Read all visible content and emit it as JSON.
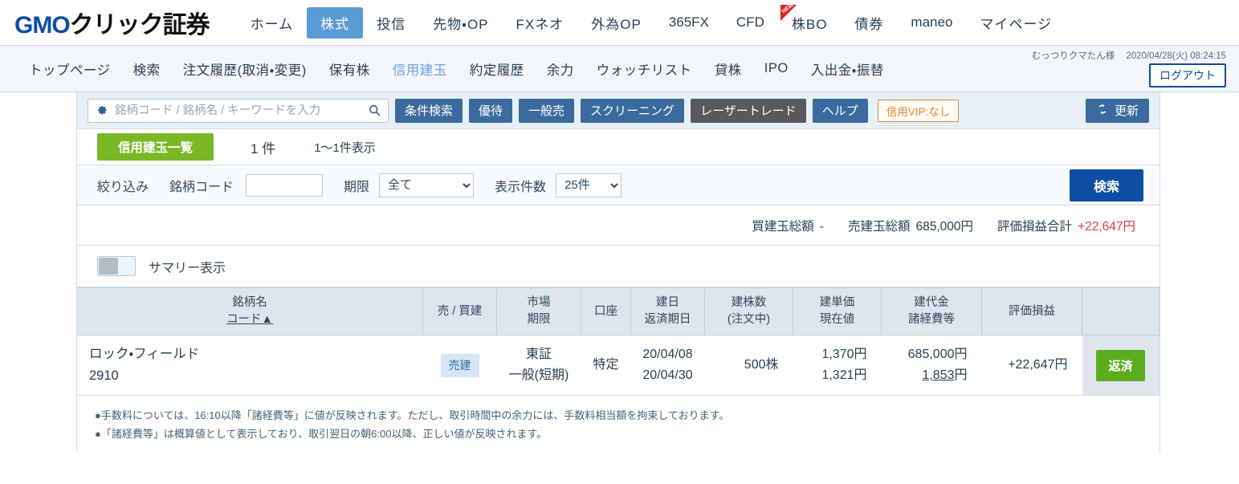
{
  "brand": {
    "gmo": "GMO",
    "name": "クリック証券"
  },
  "globalnav": [
    {
      "label": "ホーム",
      "active": false,
      "latin": false,
      "new": false
    },
    {
      "label": "株式",
      "active": true,
      "latin": false,
      "new": false
    },
    {
      "label": "投信",
      "active": false,
      "latin": false,
      "new": false
    },
    {
      "label": "先物・OP",
      "active": false,
      "latin": false,
      "new": false
    },
    {
      "label": "FXネオ",
      "active": false,
      "latin": false,
      "new": false
    },
    {
      "label": "外為OP",
      "active": false,
      "latin": false,
      "new": false
    },
    {
      "label": "365FX",
      "active": false,
      "latin": true,
      "new": false
    },
    {
      "label": "CFD",
      "active": false,
      "latin": true,
      "new": false
    },
    {
      "label": "株BO",
      "active": false,
      "latin": false,
      "new": true,
      "new_label": "NEW"
    },
    {
      "label": "債券",
      "active": false,
      "latin": false,
      "new": false
    },
    {
      "label": "maneo",
      "active": false,
      "latin": true,
      "new": false
    },
    {
      "label": "マイページ",
      "active": false,
      "latin": false,
      "new": false
    }
  ],
  "subnav": [
    {
      "label": "トップページ",
      "active": false
    },
    {
      "label": "検索",
      "active": false
    },
    {
      "label": "注文履歴(取消・変更)",
      "active": false
    },
    {
      "label": "保有株",
      "active": false
    },
    {
      "label": "信用建玉",
      "active": true
    },
    {
      "label": "約定履歴",
      "active": false
    },
    {
      "label": "余力",
      "active": false
    },
    {
      "label": "ウォッチリスト",
      "active": false
    },
    {
      "label": "貸株",
      "active": false
    },
    {
      "label": "IPO",
      "active": false
    },
    {
      "label": "入出金・振替",
      "active": false
    }
  ],
  "user": {
    "name": "むっつりクマたん様",
    "datetime": "2020/04/28(火) 08:24:15",
    "logout_label": "ログアウト"
  },
  "toolbar": {
    "search_placeholder": "銘柄コード / 銘柄名 / キーワードを入力",
    "search_value": "",
    "buttons": [
      {
        "label": "条件検索",
        "style": "blue"
      },
      {
        "label": "優待",
        "style": "blue"
      },
      {
        "label": "一般売",
        "style": "blue"
      },
      {
        "label": "スクリーニング",
        "style": "blue"
      },
      {
        "label": "レーザートレード",
        "style": "gray"
      },
      {
        "label": "ヘルプ",
        "style": "blue"
      }
    ],
    "vip_label": "信用VIP:なし",
    "refresh_label": "更新"
  },
  "countbar": {
    "tab_label": "信用建玉一覧",
    "count": "1 件",
    "display_range": "1〜1件表示"
  },
  "filter": {
    "label": "絞り込み",
    "code_label": "銘柄コード",
    "code_value": "",
    "term_label": "期限",
    "term_value": "全て",
    "term_options": [
      "全て"
    ],
    "rows_label": "表示件数",
    "rows_value": "25件",
    "rows_options": [
      "25件"
    ],
    "search_label": "検索"
  },
  "totals": {
    "buy_label": "買建玉総額",
    "buy_value": "-",
    "sell_label": "売建玉総額",
    "sell_value": "685,000円",
    "pl_label": "評価損益合計",
    "pl_value": "+22,647円"
  },
  "summary_toggle": {
    "label": "サマリー表示",
    "on": false
  },
  "table": {
    "headers": [
      {
        "line1": "銘柄名",
        "line2": "コード▲",
        "sortable": true
      },
      {
        "line1": "売 / 買建",
        "line2": "",
        "sortable": false
      },
      {
        "line1": "市場",
        "line2": "期限",
        "sortable": false
      },
      {
        "line1": "口座",
        "line2": "",
        "sortable": false
      },
      {
        "line1": "建日",
        "line2": "返済期日",
        "sortable": false
      },
      {
        "line1": "建株数",
        "line2": "(注文中)",
        "sortable": false
      },
      {
        "line1": "建単価",
        "line2": "現在値",
        "sortable": false
      },
      {
        "line1": "建代金",
        "line2": "諸経費等",
        "sortable": false
      },
      {
        "line1": "評価損益",
        "line2": "",
        "sortable": false
      },
      {
        "line1": "",
        "line2": "",
        "sortable": false
      }
    ],
    "rows": [
      {
        "name": "ロック・フィールド",
        "code": "2910",
        "side": "売建",
        "market": "東証",
        "term": "一般(短期)",
        "account": "特定",
        "open_date": "20/04/08",
        "due_date": "20/04/30",
        "shares": "500株",
        "shares_ordering": "",
        "open_price": "1,370円",
        "current_price": "1,321円",
        "amount": "685,000円",
        "fees": "1,853円",
        "pl": "+22,647円",
        "action_label": "返済"
      }
    ]
  },
  "notes": [
    "●手数料については、16:10以降「諸経費等」に値が反映されます。ただし、取引時間中の余力には、手数料相当額を拘束しております。",
    "●「諸経費等」は概算値として表示しており、取引翌日の朝6:00以降、正しい値が反映されます。"
  ],
  "colors": {
    "accent_blue": "#0b4ea2",
    "tab_blue": "#5b9bd5",
    "green": "#7ab828",
    "repay_green": "#5cad1e",
    "red": "#e23b4a",
    "orange": "#e08a2e"
  }
}
